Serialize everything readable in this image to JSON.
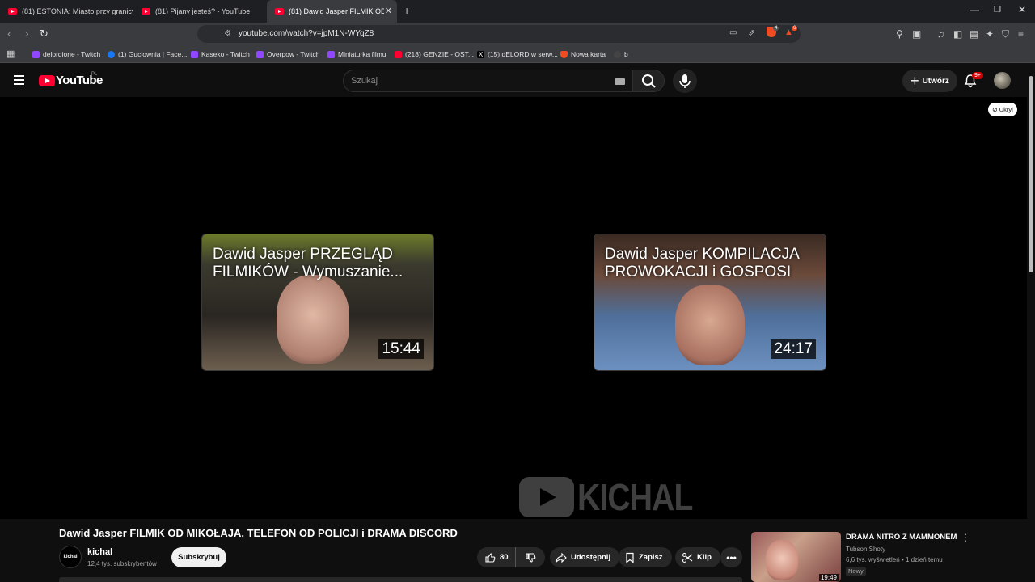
{
  "browser": {
    "tabs": [
      {
        "label": "(81) ESTONIA: Miasto przy granicy z R",
        "active": false
      },
      {
        "label": "(81) Pijany jesteś? - YouTube",
        "active": false
      },
      {
        "label": "(81) Dawid Jasper FILMIK OD MI",
        "active": true
      }
    ],
    "url": "youtube.com/watch?v=jpM1N-WYqZ8",
    "shield_count": "4",
    "ext_badge": "6",
    "bookmarks": [
      {
        "label": "delordione - Twitch",
        "color": "#9146ff"
      },
      {
        "label": "(1) Guciownia | Face...",
        "color": "#1877f2"
      },
      {
        "label": "Kaseko - Twitch",
        "color": "#9146ff"
      },
      {
        "label": "Overpow - Twitch",
        "color": "#9146ff"
      },
      {
        "label": "Miniaturka filmu",
        "color": "#9146ff"
      },
      {
        "label": "(218) GENZIE - OST...",
        "color": "#ff0033"
      },
      {
        "label": "(15) dELORD w serw...",
        "color": "#000000"
      },
      {
        "label": "Nowa karta",
        "color": "#f04b23"
      },
      {
        "label": "b",
        "color": "#444444"
      }
    ]
  },
  "youtube": {
    "logo_text": "YouTube",
    "region": "PL",
    "search_placeholder": "Szukaj",
    "create_label": "Utwórz",
    "notifications": "9+"
  },
  "player": {
    "hide_label": "Ukryj",
    "endcards": [
      {
        "title": "Dawid Jasper PRZEGLĄD FILMIKÓW - Wymuszanie...",
        "duration": "15:44"
      },
      {
        "title": "Dawid Jasper KOMPILACJA PROWOKACJI i GOSPOSI",
        "duration": "24:17"
      }
    ],
    "watermark": "KICHAL"
  },
  "video": {
    "title": "Dawid Jasper FILMIK OD MIKOŁAJA, TELEFON OD POLICJI i DRAMA DISCORD",
    "channel": "kichal",
    "channel_avatar_text": "kichal",
    "subscribers": "12,4 tys. subskrybentów",
    "subscribe_label": "Subskrybuj",
    "likes": "80",
    "share_label": "Udostępnij",
    "save_label": "Zapisz",
    "clip_label": "Klip"
  },
  "recommendation": {
    "title": "DRAMA NITRO Z MAMMONEM",
    "channel": "Tubson Shoty",
    "meta": "6,6 tys. wyświetleń • 1 dzień temu",
    "badge": "Nowy",
    "duration": "19:49"
  }
}
